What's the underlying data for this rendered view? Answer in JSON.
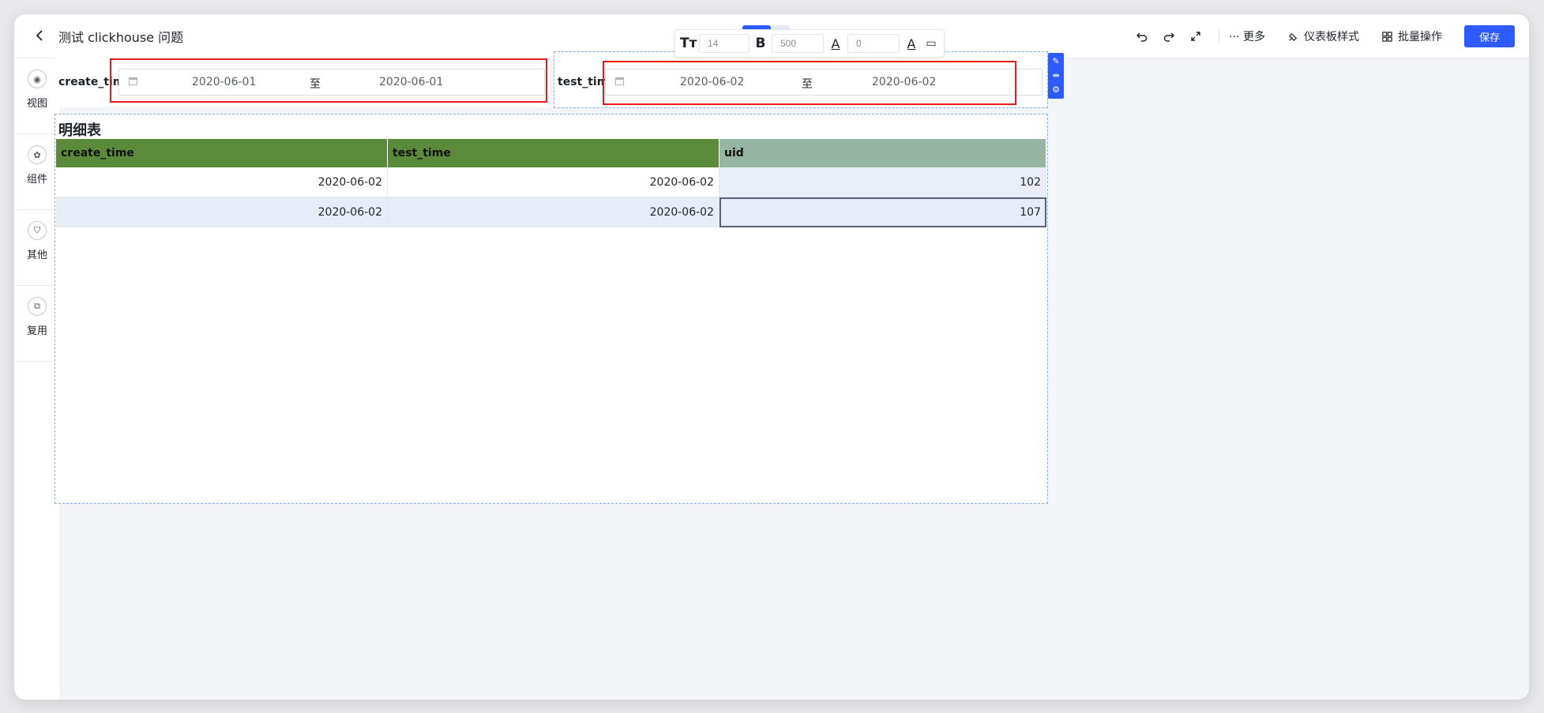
{
  "header": {
    "title": "测试 clickhouse 问题",
    "format_bar": {
      "font_size": "14",
      "font_weight": "500",
      "letter_spacing": "0"
    },
    "toolbar": {
      "more": "··· 更多",
      "dashboard_style": "仪表板样式",
      "batch_ops": "批量操作",
      "save": "保存"
    }
  },
  "sidebar": {
    "items": [
      {
        "label": "视图",
        "icon": "view-icon"
      },
      {
        "label": "组件",
        "icon": "component-icon"
      },
      {
        "label": "其他",
        "icon": "other-icon"
      },
      {
        "label": "复用",
        "icon": "reuse-icon"
      }
    ]
  },
  "filters": [
    {
      "label": "create_time",
      "start": "2020-06-01",
      "sep": "至",
      "end": "2020-06-01"
    },
    {
      "label": "test_time",
      "start": "2020-06-02",
      "sep": "至",
      "end": "2020-06-02"
    }
  ],
  "table": {
    "title": "明细表",
    "columns": [
      "create_time",
      "test_time",
      "uid"
    ],
    "rows": [
      [
        "2020-06-02",
        "2020-06-02",
        "102"
      ],
      [
        "2020-06-02",
        "2020-06-02",
        "107"
      ]
    ]
  },
  "colors": {
    "accent": "#2e5bff",
    "header_green": "#5b8b3a",
    "header_uid": "#97b5a3",
    "highlight_red": "#e41b1b"
  }
}
